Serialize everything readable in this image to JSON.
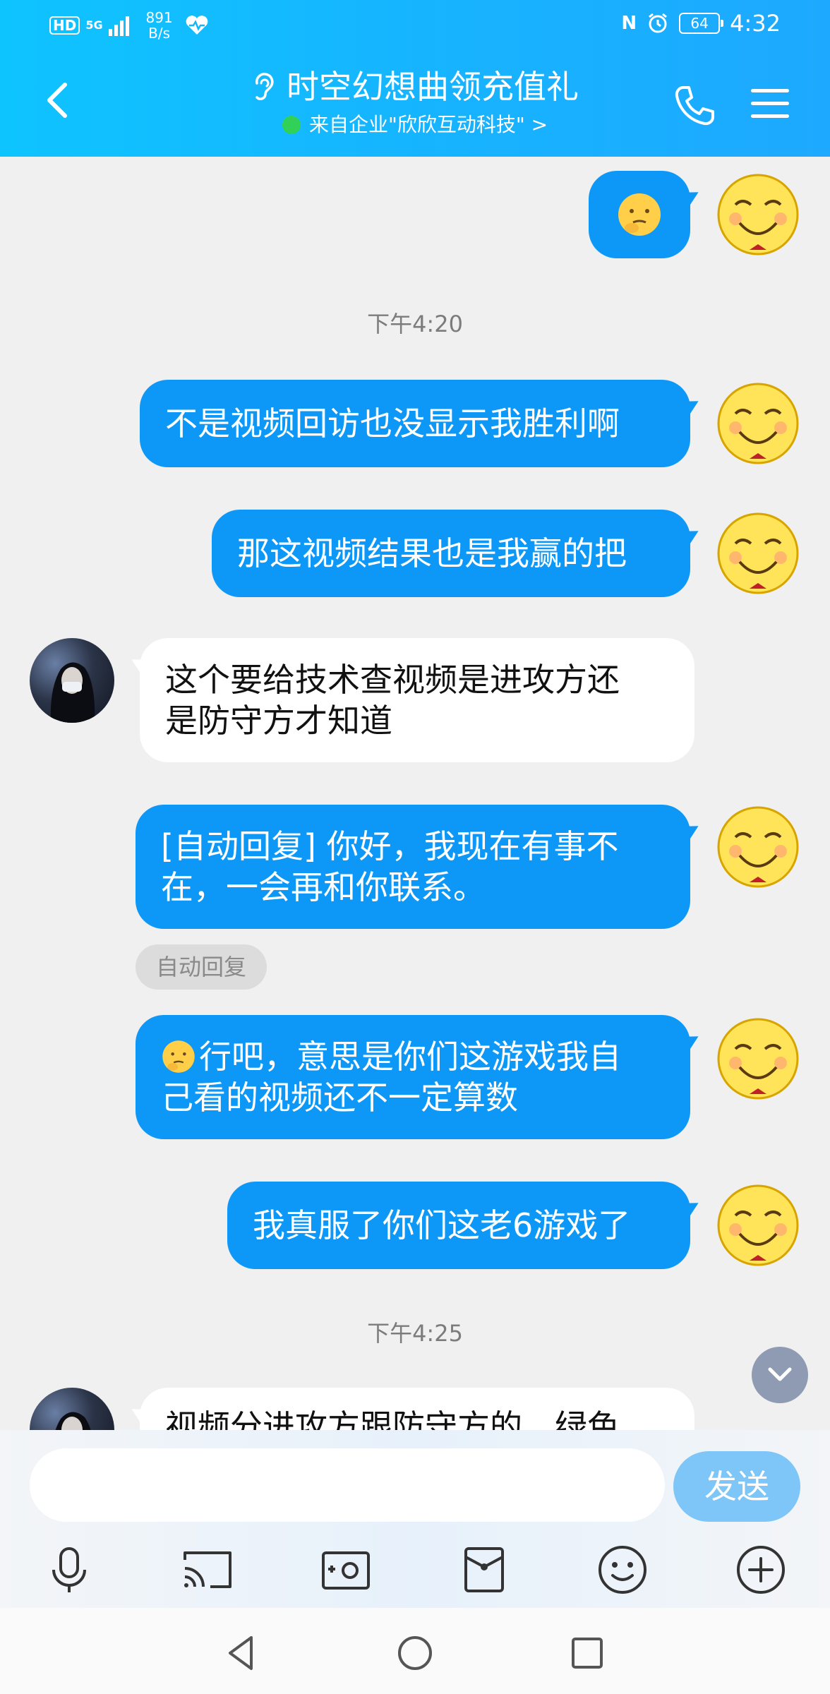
{
  "status_bar": {
    "hd": "HD",
    "network": "5G",
    "speed_value": "891",
    "speed_unit": "B/s",
    "nfc": "N",
    "battery": "64",
    "time": "4:32"
  },
  "header": {
    "title": "时空幻想曲领充值礼",
    "subtitle": "来自企业\"欣欣互动科技\" >"
  },
  "messages": {
    "m1_text": "不是视频回访也没显示我胜利啊",
    "m2_text": "那这视频结果也是我赢的把",
    "m3_line1": "这个要给技术查视频是进攻方还",
    "m3_line2": "是防守方才知道",
    "m4_line1": "[自动回复] 你好，我现在有事不",
    "m4_line2": "在，一会再和你联系。",
    "auto_reply_tag": "自动回复",
    "m5_line1": "行吧，意思是你们这游戏我自",
    "m5_line2": "己看的视频还不一定算数",
    "m6_text": "我真服了你们这老6游戏了",
    "m7_partial": "视频分进攻方跟防守方的，绿色"
  },
  "timestamps": {
    "t1": "下午4:20",
    "t2": "下午4:25"
  },
  "input": {
    "value": "",
    "placeholder": ""
  },
  "send_label": "发送",
  "colors": {
    "header_start": "#0ec4ff",
    "header_end": "#1da9ff",
    "outgoing_bubble": "#0d98f7",
    "incoming_bubble": "#ffffff",
    "send_button": "#7ec6f7",
    "chat_background": "#f0f0f0"
  },
  "icons": {
    "back": "chevron-left-icon",
    "ear": "ear-icon",
    "phone": "phone-icon",
    "menu": "hamburger-menu-icon",
    "voice": "microphone-icon",
    "cast": "screen-cast-icon",
    "photo": "photo-camera-icon",
    "bag": "red-packet-icon",
    "emoji": "emoji-icon",
    "plus": "plus-icon",
    "scroll_down": "chevron-down-icon",
    "nav_back": "triangle-back-icon",
    "nav_home": "circle-home-icon",
    "nav_recents": "square-recents-icon"
  }
}
